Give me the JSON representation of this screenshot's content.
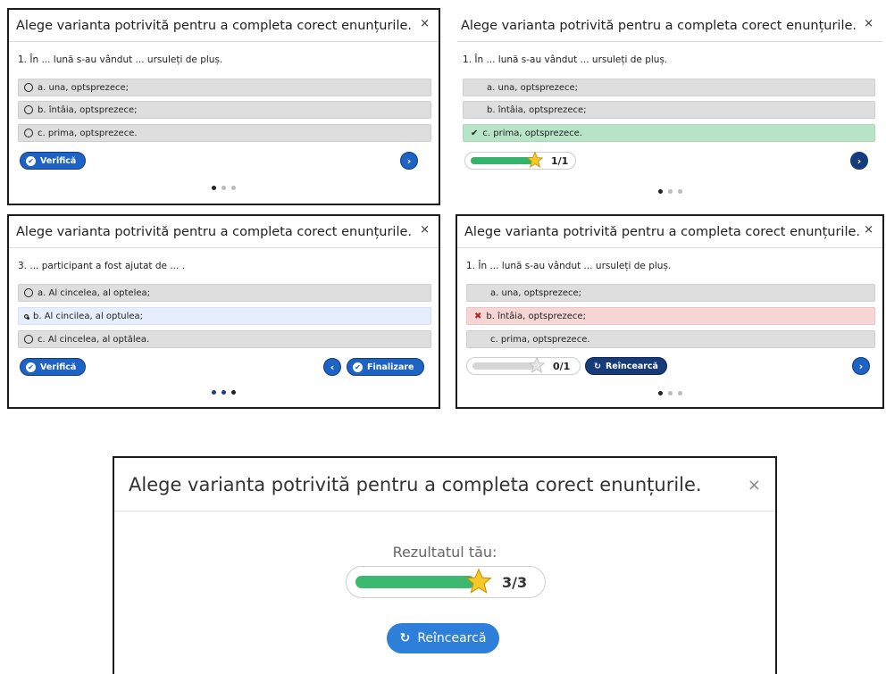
{
  "title": "Alege varianta potrivită pentru a completa corect enunțurile.",
  "close_symbol": "×",
  "colors": {
    "primary": "#1e63c4",
    "correct": "#b7e4c7",
    "wrong": "#f6d5d5",
    "progress": "#35b36a"
  },
  "panel1": {
    "question": "1. În ... lună s-au vândut ... ursuleți de pluș.",
    "options": [
      "a. una, optsprezece;",
      "b. întâia, optsprezece;",
      "c. prima, optsprezece."
    ],
    "verify_label": "Verifică",
    "next_icon": "chevron-right-icon"
  },
  "panel2": {
    "question": "1. În ... lună s-au vândut ... ursuleți de pluș.",
    "options": [
      "a. una, optsprezece;",
      "b. întâia, optsprezece;",
      "c. prima, optsprezece."
    ],
    "correct_option_index": 2,
    "progress": 1.0,
    "score": "1/1"
  },
  "panel3": {
    "question": "3. ... participant a fost ajutat de ... .",
    "options": [
      "a. Al cincelea, al optelea;",
      "b. Al cincilea, al optulea;",
      "c. Al cincelea, al optălea."
    ],
    "selected_option_index": 1,
    "verify_label": "Verifică",
    "finish_label": "Finalizare"
  },
  "panel4": {
    "question": "1. În ... lună s-au vândut ... ursuleți de pluș.",
    "options": [
      "a. una, optsprezece;",
      "b. întâia, optsprezece;",
      "c. prima, optsprezece."
    ],
    "wrong_option_index": 1,
    "progress": 0.0,
    "score": "0/1",
    "retry_label": "Reîncearcă"
  },
  "final": {
    "title": "Alege varianta potrivită pentru a completa corect enunțurile.",
    "result_label": "Rezultatul tău:",
    "progress": 1.0,
    "score": "3/3",
    "retry_label": "Reîncearcă"
  }
}
